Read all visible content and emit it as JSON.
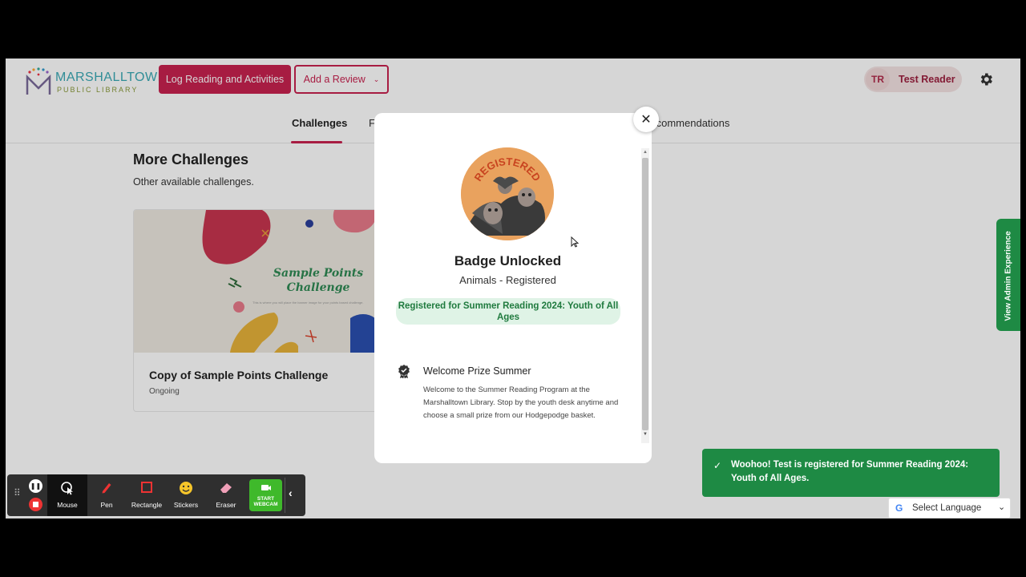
{
  "header": {
    "logo_line1": "MARSHALLTOWN",
    "logo_line2": "PUBLIC LIBRARY",
    "log_button": "Log Reading and Activities",
    "review_button": "Add a Review",
    "user_initials": "TR",
    "user_name": "Test Reader"
  },
  "nav": {
    "tabs": [
      "Challenges",
      "F",
      "Recommendations"
    ]
  },
  "main": {
    "section_title": "More Challenges",
    "section_subtitle": "Other available challenges.",
    "card": {
      "image_title": "Sample Points Challenge",
      "image_caption": "This is where you will place the banner image for your points based challenge.",
      "title": "Copy of Sample Points Challenge",
      "status": "Ongoing"
    }
  },
  "admin_tab": "View Admin Experience",
  "modal": {
    "close": "✕",
    "badge_text": "REGISTERED",
    "title": "Badge Unlocked",
    "subtitle": "Animals - Registered",
    "registration": "Registered for Summer Reading 2024: Youth of All Ages",
    "prize_title": "Welcome Prize Summer",
    "prize_description": "Welcome to the Summer Reading Program at the Marshalltown Library. Stop by the youth desk anytime and choose a small prize from our Hodgepodge basket."
  },
  "toast": {
    "message": "Woohoo! Test is registered for Summer Reading 2024: Youth of All Ages."
  },
  "language": {
    "label": "Select Language"
  },
  "recorder": {
    "tools": [
      {
        "label": "Mouse",
        "icon": "cursor-icon"
      },
      {
        "label": "Pen",
        "icon": "pen-icon"
      },
      {
        "label": "Rectangle",
        "icon": "rectangle-icon"
      },
      {
        "label": "Stickers",
        "icon": "smiley-icon"
      },
      {
        "label": "Eraser",
        "icon": "eraser-icon"
      }
    ],
    "webcam_label": "START WEBCAM"
  },
  "colors": {
    "brand": "#c8224f",
    "success": "#1e8a44",
    "success_light": "#dff3e6"
  }
}
